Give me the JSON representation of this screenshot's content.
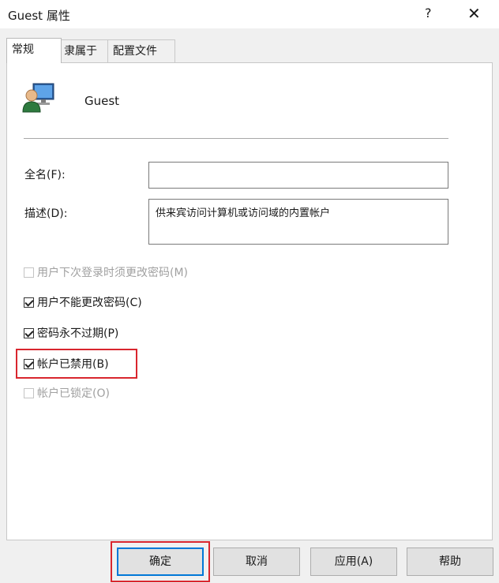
{
  "window": {
    "title": "Guest 属性",
    "help_label": "?",
    "close_label": "✕"
  },
  "tabs": [
    {
      "label": "常规",
      "active": true
    },
    {
      "label": "隶属于",
      "active": false
    },
    {
      "label": "配置文件",
      "active": false
    }
  ],
  "user": {
    "name": "Guest",
    "icon": "user-computer-icon"
  },
  "fields": {
    "fullname_label": "全名(F):",
    "fullname_value": "",
    "description_label": "描述(D):",
    "description_value": "供来宾访问计算机或访问域的内置帐户"
  },
  "checkboxes": [
    {
      "label": "用户下次登录时须更改密码(M)",
      "checked": false,
      "disabled": true
    },
    {
      "label": "用户不能更改密码(C)",
      "checked": true,
      "disabled": false
    },
    {
      "label": "密码永不过期(P)",
      "checked": true,
      "disabled": false
    },
    {
      "label": "帐户已禁用(B)",
      "checked": true,
      "disabled": false,
      "highlighted": true
    },
    {
      "label": "帐户已锁定(O)",
      "checked": false,
      "disabled": true
    }
  ],
  "buttons": {
    "ok": "确定",
    "cancel": "取消",
    "apply": "应用(A)",
    "help": "帮助"
  },
  "colors": {
    "highlight": "#d9262e",
    "focus": "#0078d7"
  }
}
